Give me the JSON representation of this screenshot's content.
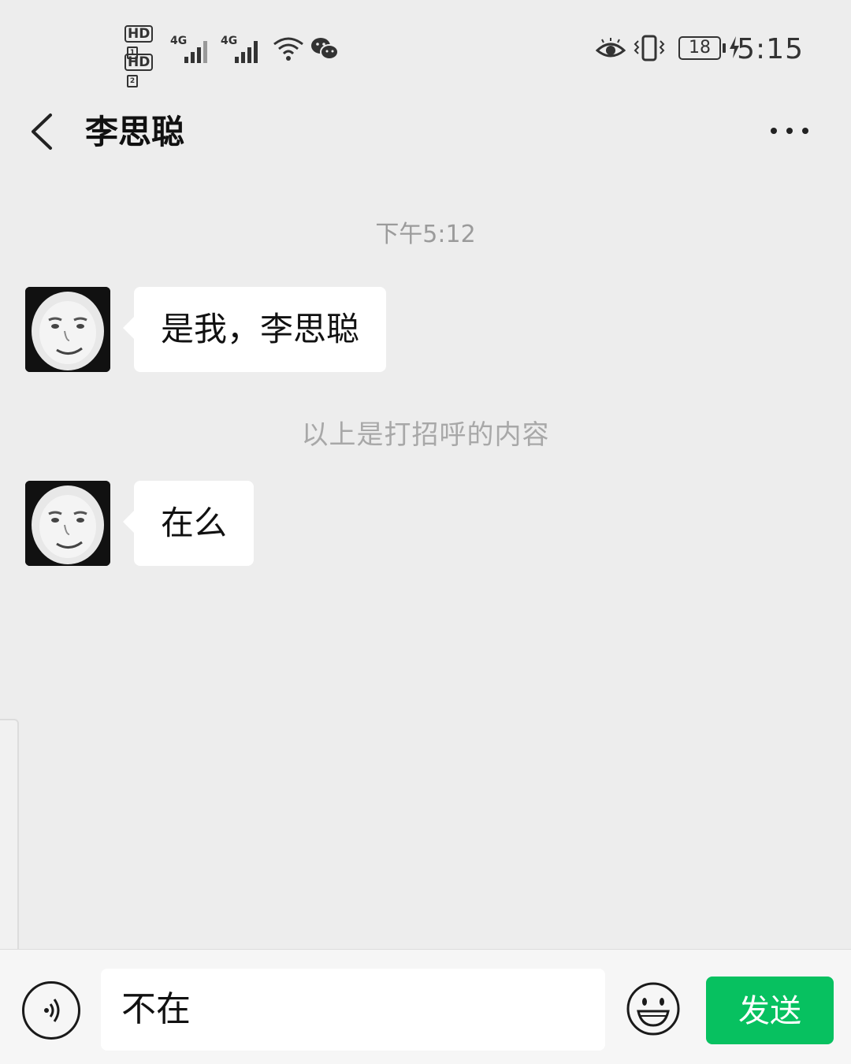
{
  "status_bar": {
    "hd1": "HD",
    "hd2": "HD",
    "sim1": "1",
    "sim2": "2",
    "net1": "4G",
    "net2": "4G",
    "battery": "18",
    "time": "5:15"
  },
  "header": {
    "title": "李思聪"
  },
  "chat": {
    "timestamp": "下午5:12",
    "messages": [
      {
        "text": "是我，李思聪"
      },
      {
        "text": "在么"
      }
    ],
    "system_notice": "以上是打招呼的内容"
  },
  "input_bar": {
    "value": "不在",
    "send_label": "发送"
  },
  "colors": {
    "background": "#ededed",
    "send_button": "#07c160",
    "bubble": "#ffffff"
  },
  "icons": [
    "back-chevron-icon",
    "more-dots-icon",
    "voice-icon",
    "emoji-icon",
    "wifi-icon",
    "wechat-icon",
    "eye-icon",
    "vibrate-icon",
    "charging-icon"
  ]
}
